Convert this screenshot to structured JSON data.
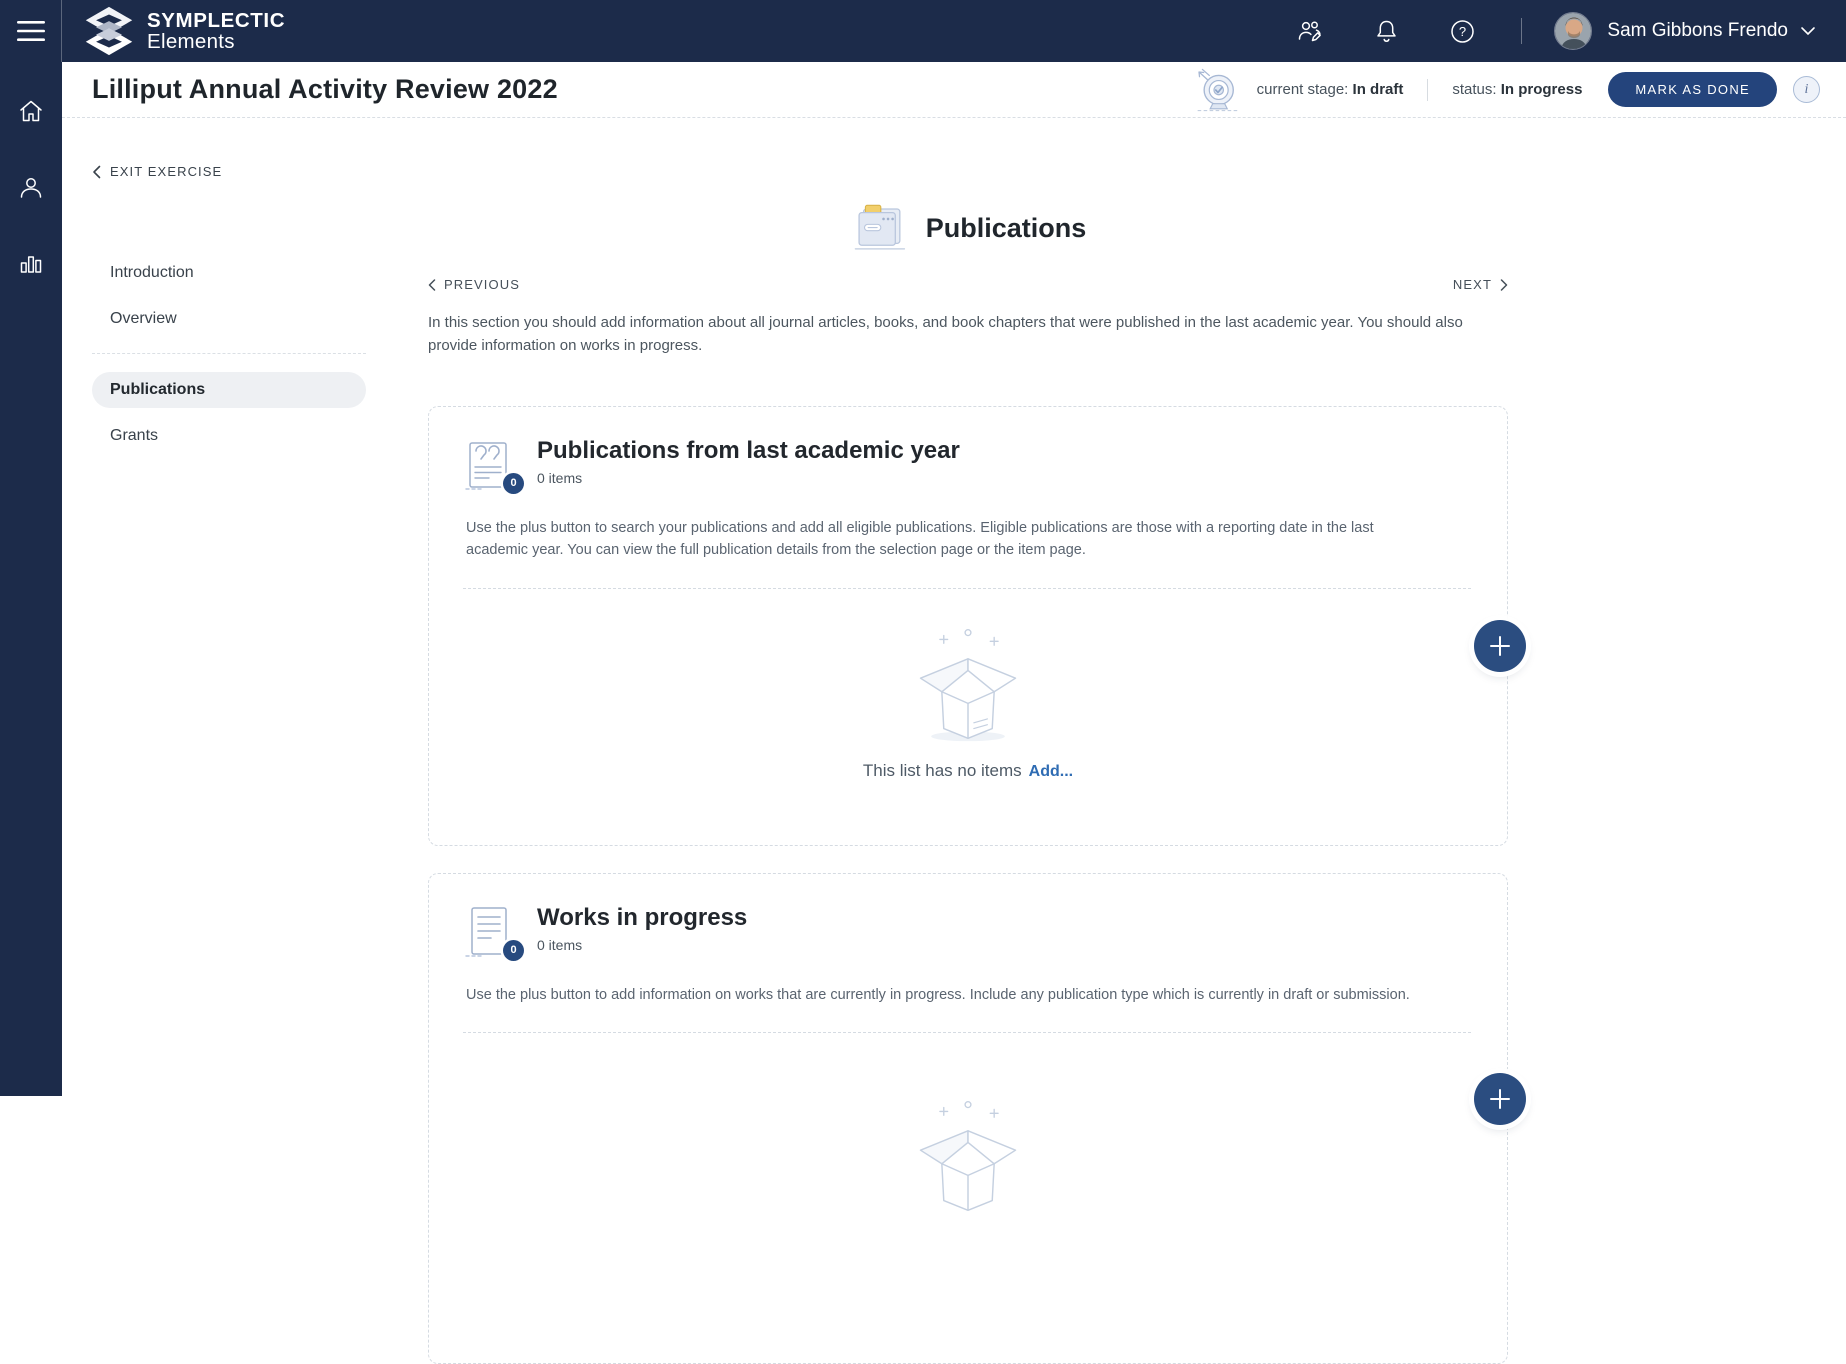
{
  "header": {
    "logo_line1": "SYMPLECTIC",
    "logo_line2": "Elements",
    "user_name": "Sam Gibbons Frendo",
    "icons": [
      "menu-icon",
      "user-management-icon",
      "notifications-bell-icon",
      "help-icon",
      "chevron-down-icon"
    ]
  },
  "rail": {
    "icons": [
      "home-icon",
      "profile-icon",
      "reports-icon"
    ]
  },
  "title_bar": {
    "title": "Lilliput Annual Activity Review 2022",
    "current_stage_label": "current stage:",
    "current_stage_value": "In draft",
    "status_label": "status:",
    "status_value": "In progress",
    "mark_as_done_label": "MARK AS DONE",
    "info_icon": "i"
  },
  "nav": {
    "exit_label": "EXIT EXERCISE",
    "items": [
      {
        "label": "Introduction",
        "active": false
      },
      {
        "label": "Overview",
        "active": false
      },
      {
        "label": "Publications",
        "active": true
      },
      {
        "label": "Grants",
        "active": false
      }
    ]
  },
  "section": {
    "title": "Publications",
    "previous_label": "PREVIOUS",
    "next_label": "NEXT",
    "intro": "In this section you should add information about all journal articles, books, and book chapters that were published in the last academic year. You should also provide information on works in progress."
  },
  "cards": [
    {
      "title": "Publications from last academic year",
      "items_count": "0 items",
      "badge": "0",
      "description": "Use the plus button to search your publications and add all eligible publications. Eligible publications are those with a reporting date in the last academic year. You can view the full publication details from the selection page or the item page.",
      "empty_text": "This list has no items",
      "add_label": "Add..."
    },
    {
      "title": "Works in progress",
      "items_count": "0 items",
      "badge": "0",
      "description": "Use the plus button to add information on works that are currently in progress. Include any publication type which is currently in draft or submission."
    }
  ],
  "colors": {
    "navy_header": "#1c2b4a",
    "accent_navy": "#274a7f",
    "link_blue": "#2f6cb3",
    "illustration_blue": "#c5d0e0",
    "folder_tab_yellow": "#f2cf6b"
  }
}
